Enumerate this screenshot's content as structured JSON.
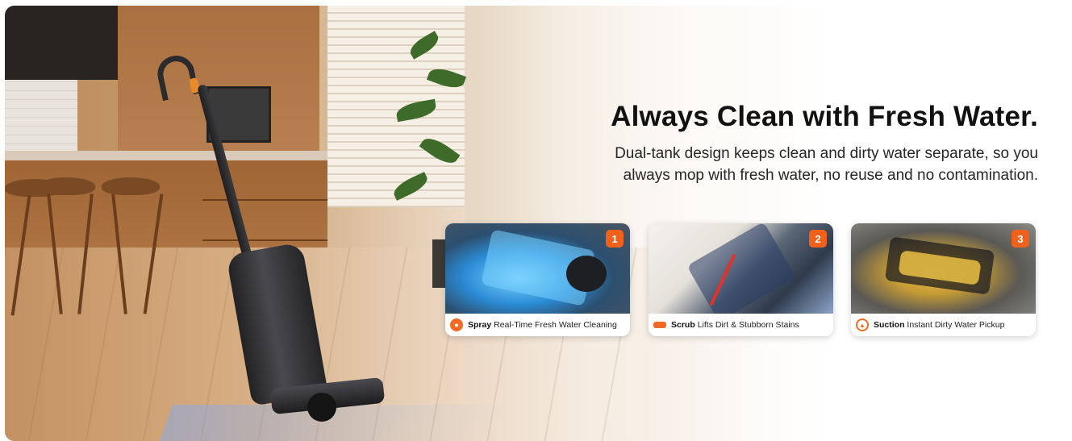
{
  "hero": {
    "headline": "Always Clean with Fresh Water.",
    "subtext_line1": "Dual-tank design keeps clean and dirty water separate, so you",
    "subtext_line2": "always mop with fresh water, no reuse and no contamination."
  },
  "features": [
    {
      "number": "1",
      "icon": "water-drop-icon",
      "title": "Spray",
      "description": "Real-Time Fresh Water Cleaning"
    },
    {
      "number": "2",
      "icon": "brush-roller-icon",
      "title": "Scrub",
      "description": "Lifts Dirt & Stubborn Stains"
    },
    {
      "number": "3",
      "icon": "suction-triangle-icon",
      "title": "Suction",
      "description": "Instant Dirty Water Pickup"
    }
  ],
  "colors": {
    "accent": "#f2611c",
    "text": "#111111"
  }
}
